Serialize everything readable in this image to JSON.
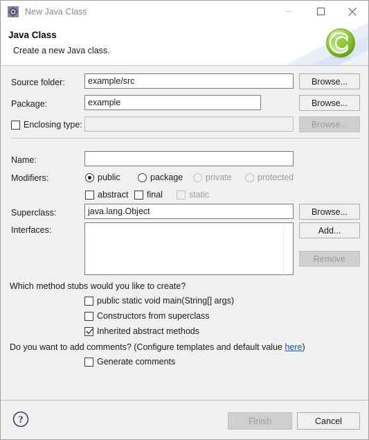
{
  "window": {
    "title": "New Java Class",
    "icon": "java-wizard-icon",
    "controls": {
      "minimize": "minimize-icon",
      "maximize": "maximize-icon",
      "close": "close-icon"
    }
  },
  "header": {
    "title": "Java Class",
    "subtitle": "Create a new Java class.",
    "logo": "eclipse-java-class-logo",
    "accent_green": "#8dc63f",
    "deco_blue": "#e4ecf7"
  },
  "form": {
    "source_folder": {
      "label": "Source folder:",
      "value": "example/src",
      "placeholder": "",
      "browse": "Browse...",
      "enabled": true
    },
    "package": {
      "label": "Package:",
      "value": "example",
      "placeholder": "",
      "browse": "Browse...",
      "enabled": true
    },
    "enclosing_type": {
      "label": "Enclosing type:",
      "checked": false,
      "value": "",
      "placeholder": "",
      "browse": "Browse...",
      "enabled": false
    },
    "name": {
      "label": "Name:",
      "value": "",
      "placeholder": ""
    },
    "modifiers": {
      "label": "Modifiers:",
      "radios": [
        {
          "label": "public",
          "selected": true,
          "enabled": true
        },
        {
          "label": "package",
          "selected": false,
          "enabled": true
        },
        {
          "label": "private",
          "selected": false,
          "enabled": false
        },
        {
          "label": "protected",
          "selected": false,
          "enabled": false
        }
      ],
      "checkboxes": [
        {
          "label": "abstract",
          "checked": false,
          "enabled": true
        },
        {
          "label": "final",
          "checked": false,
          "enabled": true
        },
        {
          "label": "static",
          "checked": false,
          "enabled": false
        }
      ]
    },
    "superclass": {
      "label": "Superclass:",
      "value": "java.lang.Object",
      "placeholder": "",
      "browse": "Browse..."
    },
    "interfaces": {
      "label": "Interfaces:",
      "items": [],
      "add": "Add...",
      "remove": "Remove",
      "remove_enabled": false
    },
    "method_stubs": {
      "question": "Which method stubs would you like to create?",
      "options": [
        {
          "label": "public static void main(String[] args)",
          "checked": false
        },
        {
          "label": "Constructors from superclass",
          "checked": false
        },
        {
          "label": "Inherited abstract methods",
          "checked": true
        }
      ]
    },
    "comments": {
      "question_prefix": "Do you want to add comments? (Configure templates and default value ",
      "link": "here",
      "question_suffix": ")",
      "option": {
        "label": "Generate comments",
        "checked": false
      }
    }
  },
  "footer": {
    "help": "help-icon",
    "finish": {
      "label": "Finish",
      "enabled": false
    },
    "cancel": {
      "label": "Cancel",
      "enabled": true
    }
  }
}
